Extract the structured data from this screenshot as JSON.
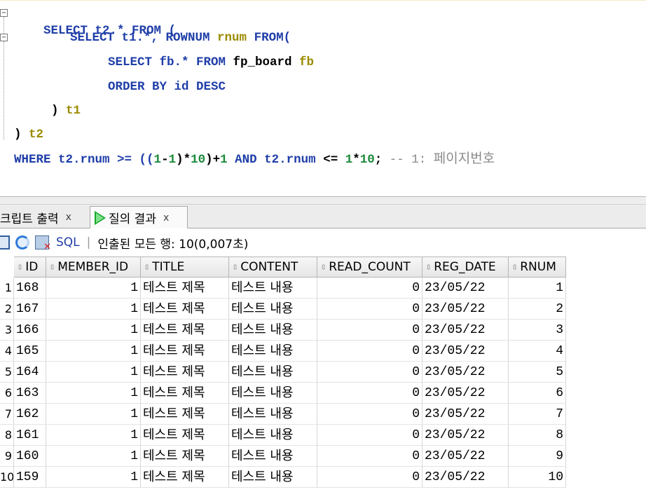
{
  "editor": {
    "line1": {
      "a": "SELECT t2.* FROM ("
    },
    "line2": {
      "a": "SELECT t1.*, ",
      "b": "ROWNUM",
      "c": " rnum ",
      "d": "FROM("
    },
    "line3": {
      "a": "SELECT fb.* FROM ",
      "b": "fp_board",
      "c": " fb"
    },
    "line4": {
      "a": "ORDER BY id DESC"
    },
    "line5": {
      "a": ") ",
      "b": "t1"
    },
    "line6": {
      "a": ") ",
      "b": "t2"
    },
    "line7": {
      "a": "WHERE",
      "b": " t2.rnum >= ((",
      "c": "1",
      "d": "-",
      "e": "1",
      "f": ")*",
      "g": "10",
      "h": ")+",
      "i": "1",
      "j": " AND ",
      "k": "t2.rnum",
      "l": " <= ",
      "m": "1",
      "n": "*",
      "o": "10",
      "p": "; ",
      "comment": "-- 1: ",
      "comment_ko": "페이지번호"
    }
  },
  "tabs": {
    "script": {
      "label": "크립트 출력",
      "close": "x"
    },
    "result": {
      "label": "질의 결과",
      "close": "x"
    }
  },
  "toolbar": {
    "sql_label": "SQL",
    "separator": "|",
    "status": "인출된 모든 행: 10(0,007초)"
  },
  "grid": {
    "columns": [
      "ID",
      "MEMBER_ID",
      "TITLE",
      "CONTENT",
      "READ_COUNT",
      "REG_DATE",
      "RNUM"
    ],
    "rows": [
      {
        "n": "1",
        "id": "168",
        "member_id": "1",
        "title": "테스트 제목",
        "content": "테스트 내용",
        "read_count": "0",
        "reg_date": "23/05/22",
        "rnum": "1"
      },
      {
        "n": "2",
        "id": "167",
        "member_id": "1",
        "title": "테스트 제목",
        "content": "테스트 내용",
        "read_count": "0",
        "reg_date": "23/05/22",
        "rnum": "2"
      },
      {
        "n": "3",
        "id": "166",
        "member_id": "1",
        "title": "테스트 제목",
        "content": "테스트 내용",
        "read_count": "0",
        "reg_date": "23/05/22",
        "rnum": "3"
      },
      {
        "n": "4",
        "id": "165",
        "member_id": "1",
        "title": "테스트 제목",
        "content": "테스트 내용",
        "read_count": "0",
        "reg_date": "23/05/22",
        "rnum": "4"
      },
      {
        "n": "5",
        "id": "164",
        "member_id": "1",
        "title": "테스트 제목",
        "content": "테스트 내용",
        "read_count": "0",
        "reg_date": "23/05/22",
        "rnum": "5"
      },
      {
        "n": "6",
        "id": "163",
        "member_id": "1",
        "title": "테스트 제목",
        "content": "테스트 내용",
        "read_count": "0",
        "reg_date": "23/05/22",
        "rnum": "6"
      },
      {
        "n": "7",
        "id": "162",
        "member_id": "1",
        "title": "테스트 제목",
        "content": "테스트 내용",
        "read_count": "0",
        "reg_date": "23/05/22",
        "rnum": "7"
      },
      {
        "n": "8",
        "id": "161",
        "member_id": "1",
        "title": "테스트 제목",
        "content": "테스트 내용",
        "read_count": "0",
        "reg_date": "23/05/22",
        "rnum": "8"
      },
      {
        "n": "9",
        "id": "160",
        "member_id": "1",
        "title": "테스트 제목",
        "content": "테스트 내용",
        "read_count": "0",
        "reg_date": "23/05/22",
        "rnum": "9"
      },
      {
        "n": "10",
        "id": "159",
        "member_id": "1",
        "title": "테스트 제목",
        "content": "테스트 내용",
        "read_count": "0",
        "reg_date": "23/05/22",
        "rnum": "10"
      }
    ]
  }
}
